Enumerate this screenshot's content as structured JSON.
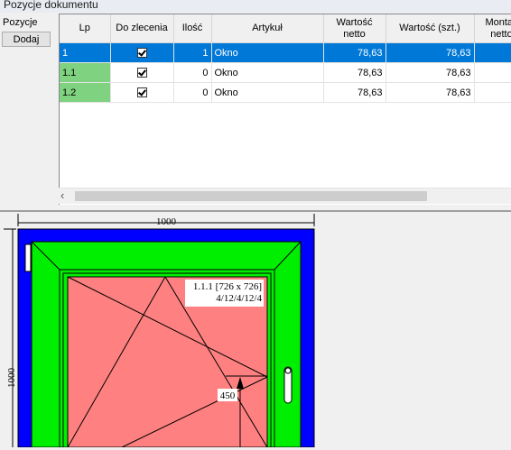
{
  "window": {
    "title": "Pozycje dokumentu"
  },
  "sidebar": {
    "label": "Pozycje",
    "add_button": "Dodaj"
  },
  "grid": {
    "columns": [
      "Lp",
      "Do zlecenia",
      "Ilość",
      "Artykuł",
      "Wartość netto",
      "Wartość (szt.)",
      "Montaż netto"
    ],
    "rows": [
      {
        "lp": "1",
        "do_zlecenia": true,
        "ilosc": "1",
        "artykul": "Okno",
        "wartosc_netto": "78,63",
        "wartosc_szt": "78,63"
      },
      {
        "lp": "1.1",
        "do_zlecenia": true,
        "ilosc": "0",
        "artykul": "Okno",
        "wartosc_netto": "78,63",
        "wartosc_szt": "78,63"
      },
      {
        "lp": "1.2",
        "do_zlecenia": true,
        "ilosc": "0",
        "artykul": "Okno",
        "wartosc_netto": "78,63",
        "wartosc_szt": "78,63"
      }
    ]
  },
  "drawing": {
    "width_dim": "1000",
    "height_dim": "1000",
    "sash_label_line1": "1.1.1 [726 x 726]",
    "sash_label_line2": "4/12/4/12/4",
    "handle_dim": "450",
    "colors": {
      "frame": "#0000ff",
      "sash": "#00ee00",
      "glass": "#ff8080"
    }
  }
}
